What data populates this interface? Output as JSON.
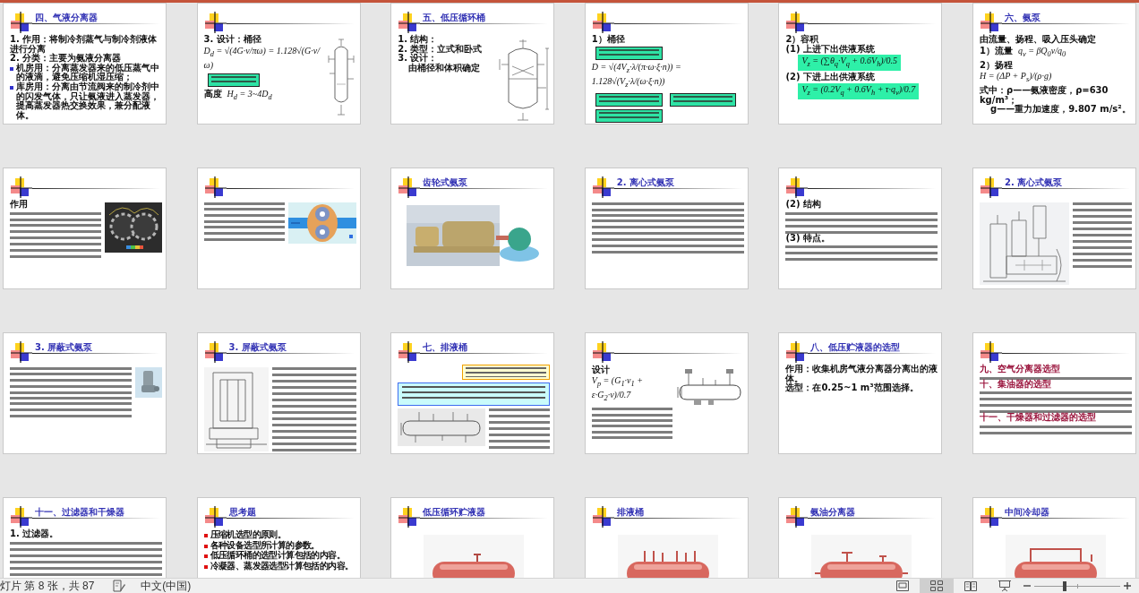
{
  "slides": [
    {
      "title": "四、气液分离器",
      "body": [
        {
          "kind": "item",
          "text": "1. 作用：将制冷剂蒸气与制冷剂液体进行分离"
        },
        {
          "kind": "item",
          "text": "2. 分类：主要为氨液分离器"
        },
        {
          "kind": "bullet",
          "text": "机房用：分离蒸发器来的低压蒸气中的液滴，避免压缩机湿压缩；"
        },
        {
          "kind": "bullet",
          "text": "库房用：分离由节流阀来的制冷剂中的闪发气体，只让氨液进入蒸发器，提高蒸发器热交换效果，兼分配液体。"
        }
      ]
    },
    {
      "body": [
        {
          "kind": "item",
          "text": "3. 设计：桶径"
        },
        {
          "kind": "formula",
          "text": "D$_{d}$ = √(4G·v/πω) = 1.128√(G·v/ω)"
        },
        {
          "kind": "callout"
        },
        {
          "kind": "formula",
          "label": "高度",
          "text": "H$_{d}$ = 3~4D$_{d}$"
        }
      ],
      "side": [
        {
          "kind": "figure"
        }
      ]
    },
    {
      "title": "五、低压循环桶",
      "body": [
        {
          "kind": "item",
          "text": "1. 结构："
        },
        {
          "kind": "item",
          "text": "2. 类型：立式和卧式"
        },
        {
          "kind": "item",
          "text": "3. 设计："
        },
        {
          "kind": "indent",
          "text": "由桶径和体积确定"
        }
      ],
      "side": [
        {
          "kind": "figure"
        }
      ]
    },
    {
      "body": [
        {
          "kind": "item",
          "text": "1）桶径"
        },
        {
          "kind": "callout"
        },
        {
          "kind": "formula",
          "text": "D = √(4V$_{z}$·λ/(π·ω·ξ·n)) = 1.128√(V$_{z}$·λ/(ω·ξ·n))"
        },
        {
          "kind": "callout"
        },
        {
          "kind": "callout"
        },
        {
          "kind": "callout"
        }
      ]
    },
    {
      "body": [
        {
          "kind": "item",
          "text": "2）容积"
        },
        {
          "kind": "item",
          "text": "(1) 上进下出供液系统"
        },
        {
          "kind": "formula-box",
          "text": "V$_{z}$ = (∑θ$_{q}$·V$_{q}$ + 0.6V$_{h}$)/0.5"
        },
        {
          "kind": "item",
          "text": "(2) 下进上出供液系统"
        },
        {
          "kind": "formula-box",
          "text": "V$_{z}$ = (0.2V$_{q}$ + 0.6V$_{h}$ + τ·q$_{v}$)/0.7"
        }
      ]
    },
    {
      "title": "六、氨泵",
      "body": [
        {
          "kind": "item",
          "text": "由流量、扬程、吸入压头确定"
        },
        {
          "kind": "formula",
          "label": "1）流量",
          "text": "q$_{v}$ = βQ$_{0}$v/q$_{0}$"
        },
        {
          "kind": "item",
          "text": "2）扬程"
        },
        {
          "kind": "formula",
          "text": "H = (ΔP + P$_{s}$)/(ρ·g)"
        },
        {
          "kind": "item",
          "text": "式中：ρ——氨液密度，ρ=630 kg/m³；"
        },
        {
          "kind": "indent",
          "text": "g——重力加速度，9.807 m/s²。"
        }
      ]
    },
    {
      "body": [
        {
          "kind": "item",
          "text": "作用"
        },
        {
          "kind": "fine-print"
        },
        {
          "kind": "fine-print"
        }
      ],
      "side": [
        {
          "kind": "figure"
        }
      ]
    },
    {
      "body": [
        {
          "kind": "fine-print"
        },
        {
          "kind": "fine-print"
        },
        {
          "kind": "fine-print"
        }
      ],
      "side": [
        {
          "kind": "figure"
        }
      ]
    },
    {
      "title": "齿轮式氨泵",
      "body": [
        {
          "kind": "figure"
        }
      ]
    },
    {
      "title": "2. 离心式氨泵",
      "body": [
        {
          "kind": "fine-print"
        },
        {
          "kind": "fine-print"
        },
        {
          "kind": "fine-print"
        }
      ]
    },
    {
      "body": [
        {
          "kind": "item",
          "text": "(2) 结构"
        },
        {
          "kind": "fine-print"
        },
        {
          "kind": "item",
          "text": "(3) 特点。"
        },
        {
          "kind": "fine-print"
        }
      ]
    },
    {
      "title": "2. 离心式氨泵",
      "body": [
        {
          "kind": "figure"
        },
        {
          "kind": "fine-print"
        }
      ]
    },
    {
      "title": "3. 屏蔽式氨泵",
      "body": [
        {
          "kind": "fine-print"
        },
        {
          "kind": "fine-print"
        },
        {
          "kind": "fine-print"
        },
        {
          "kind": "fine-print"
        }
      ],
      "side": [
        {
          "kind": "figure"
        }
      ]
    },
    {
      "title": "3. 屏蔽式氨泵",
      "body": [
        {
          "kind": "figure"
        },
        {
          "kind": "fine-print"
        }
      ]
    },
    {
      "title": "七、排液桶",
      "body": [
        {
          "kind": "banner"
        },
        {
          "kind": "note"
        },
        {
          "kind": "figure"
        },
        {
          "kind": "fine-print"
        }
      ]
    },
    {
      "body": [
        {
          "kind": "formula",
          "label": "设计",
          "text": "V$_{p}$ = (G$_{1}$·v$_{1}$ + ε·G$_{2}$·v)/0.7"
        },
        {
          "kind": "fine-print"
        },
        {
          "kind": "fine-print"
        },
        {
          "kind": "fine-print"
        },
        {
          "kind": "fine-print"
        }
      ],
      "side": [
        {
          "kind": "figure"
        }
      ]
    },
    {
      "title": "八、低压贮液器的选型",
      "body": [
        {
          "kind": "item",
          "text": "作用：收集机房气液分离器分离出的液体。"
        },
        {
          "kind": "item",
          "text": "选型：在0.25~1 m³范围选择。"
        }
      ]
    },
    {
      "body": [
        {
          "kind": "heading",
          "text": "九、空气分离器选型"
        },
        {
          "kind": "fine-print"
        },
        {
          "kind": "heading",
          "text": "十、集油器的选型"
        },
        {
          "kind": "fine-print"
        },
        {
          "kind": "heading",
          "text": "十一、干燥器和过滤器的选型"
        },
        {
          "kind": "fine-print"
        }
      ]
    },
    {
      "title": "十一、过滤器和干燥器",
      "body": [
        {
          "kind": "item",
          "text": "1. 过滤器。"
        },
        {
          "kind": "fine-print"
        }
      ]
    },
    {
      "title": "思考题",
      "body": [
        {
          "kind": "point",
          "text": "压缩机选型的原则。"
        },
        {
          "kind": "point",
          "text": "各种设备选型所计算的参数。"
        },
        {
          "kind": "point",
          "text": "低压循环桶的选型计算包括的内容。"
        },
        {
          "kind": "point",
          "text": "冷凝器、蒸发器选型计算包括的内容。"
        }
      ]
    },
    {
      "title": "低压循环贮液器",
      "body": [
        {
          "kind": "figure"
        }
      ]
    },
    {
      "title": "排液桶",
      "body": [
        {
          "kind": "figure"
        }
      ]
    },
    {
      "title": "氨油分离器",
      "body": [
        {
          "kind": "figure"
        }
      ]
    },
    {
      "title": "中间冷却器",
      "body": [
        {
          "kind": "figure"
        }
      ]
    }
  ],
  "status_bar": {
    "slide_counter": "灯片 第 8 张，共 87",
    "language": "中文(中国)",
    "views": [
      {
        "selected": false
      },
      {
        "selected": true
      },
      {
        "selected": false
      },
      {
        "selected": false
      }
    ],
    "zoom": {
      "level": 0.35
    }
  }
}
